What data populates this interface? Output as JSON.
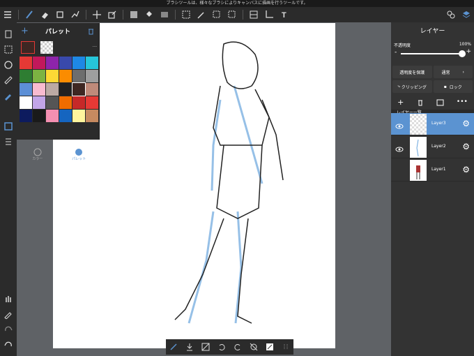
{
  "status_text": "ブラシツールは、様々なブラシによりキャンバスに描画を行うツールです。",
  "palette": {
    "title": "パレット",
    "current_value": "---",
    "tabs": [
      "カラー",
      "パレット"
    ],
    "swatches": [
      "#e53935",
      "#c2185b",
      "#8e24aa",
      "#3949ab",
      "#1e88e5",
      "#26c6da",
      "#2e7d32",
      "#7cb342",
      "#fdd835",
      "#fb8c00",
      "#6d6d6d",
      "#9e9e9e",
      "#5c8fd6",
      "#f8bbd0",
      "#bcaaa4",
      "#212121",
      "#3e2723",
      "#bf8a7a",
      "#ffffff",
      "#c2a5e8",
      "#555555",
      "#ef6c00",
      "#c62828",
      "#e53935",
      "#0d1b5e",
      "#1a1a1a",
      "#f48fb1",
      "#1565c0",
      "#fff59d",
      "#c68a60"
    ]
  },
  "layers_panel": {
    "title": "レイヤー",
    "opacity_label": "不透明度",
    "opacity_value": "100%",
    "opacity_level": 1.0,
    "protect_label": "透明度を保護",
    "blend_label": "通常",
    "clipping_label": "クリッピング",
    "lock_label": "ロック",
    "list_label": "レイヤー一覧",
    "layers": [
      {
        "name": "Layer3",
        "selected": true
      },
      {
        "name": "Layer2",
        "selected": false
      },
      {
        "name": "Layer1",
        "selected": false
      }
    ]
  },
  "colors": {
    "accent": "#5b93d1",
    "toolbar": "#2b2b2b",
    "panel": "#333333"
  }
}
